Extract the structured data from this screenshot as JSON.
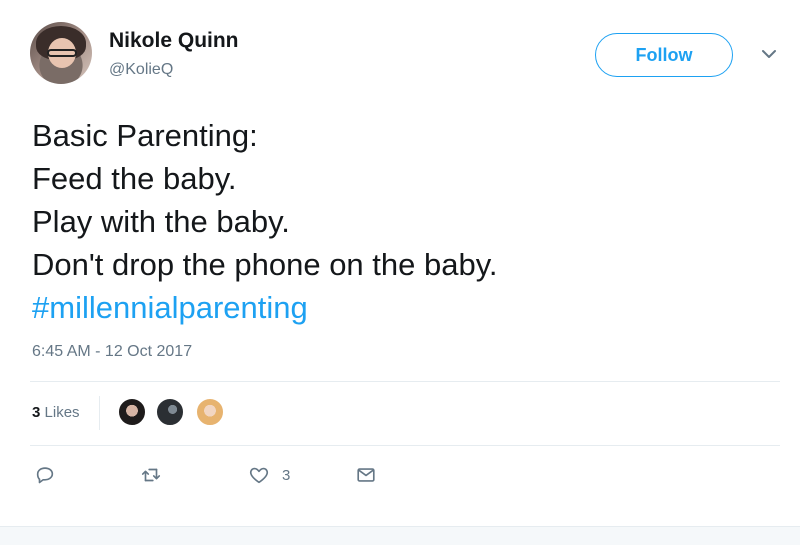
{
  "author": {
    "display_name": "Nikole Quinn",
    "handle": "@KolieQ"
  },
  "follow_label": "Follow",
  "tweet": {
    "lines": [
      "Basic Parenting:",
      "Feed the baby.",
      "Play with the baby.",
      "Don't drop the phone on the baby."
    ],
    "hashtag": "#millennialparenting",
    "timestamp": "6:45 AM - 12 Oct 2017"
  },
  "stats": {
    "likes_count": "3",
    "likes_label": "Likes"
  },
  "actions": {
    "like_count": "3"
  },
  "colors": {
    "accent": "#1da1f2",
    "secondary_text": "#657786",
    "divider": "#e6ecf0"
  },
  "icons": [
    "chevron-down-icon",
    "reply-icon",
    "retweet-icon",
    "heart-icon",
    "envelope-icon"
  ]
}
